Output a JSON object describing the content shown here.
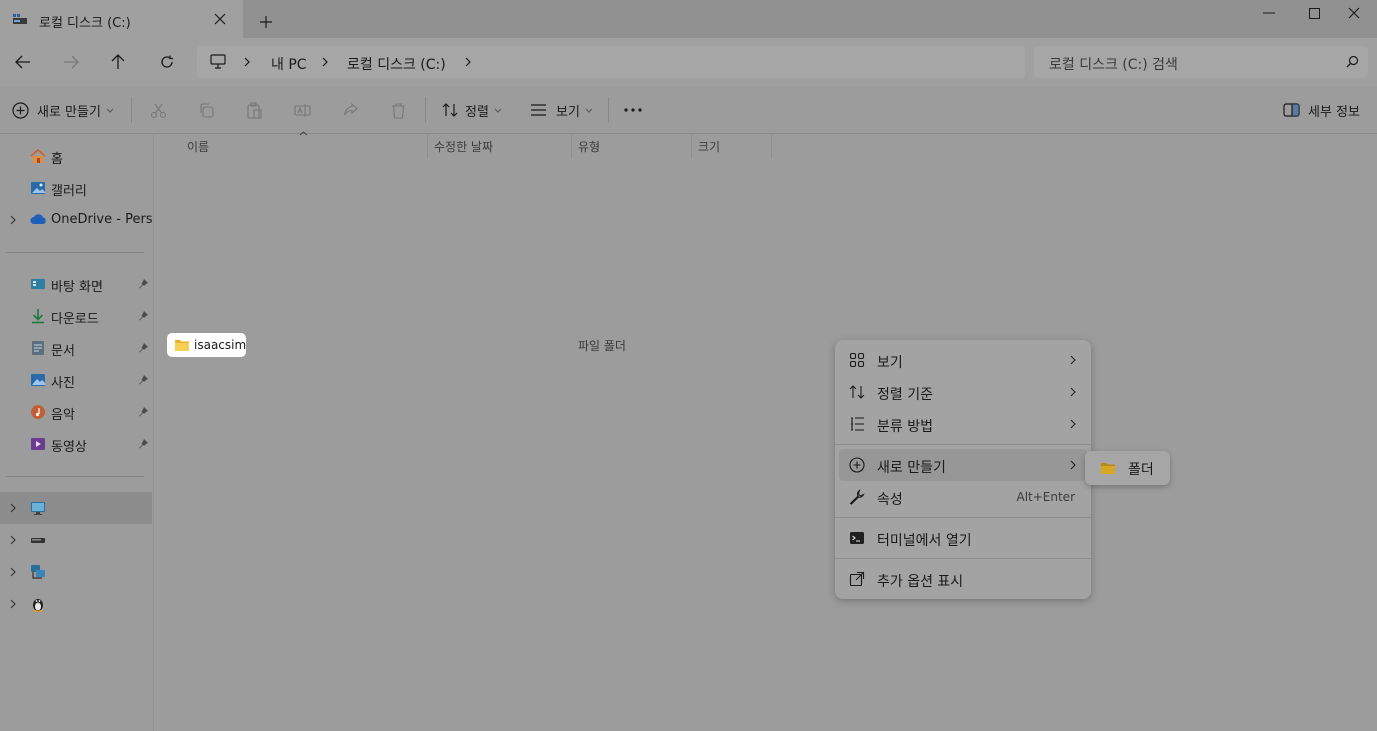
{
  "window": {
    "tab_title": "로컬 디스크 (C:)"
  },
  "address": {
    "crumbs": [
      "내 PC",
      "로컬 디스크 (C:)"
    ],
    "search_placeholder": "로컬 디스크 (C:) 검색"
  },
  "toolbar": {
    "new_label": "새로 만들기",
    "sort_label": "정렬",
    "view_label": "보기",
    "details_label": "세부 정보"
  },
  "sidebar": {
    "top_items": [
      {
        "label": "홈",
        "icon": "home-icon"
      },
      {
        "label": "갤러리",
        "icon": "gallery-icon"
      },
      {
        "label": "OneDrive - Personal",
        "icon": "onedrive-icon"
      }
    ],
    "quick_items": [
      {
        "label": "바탕 화면",
        "icon": "desktop-icon"
      },
      {
        "label": "다운로드",
        "icon": "download-icon"
      },
      {
        "label": "문서",
        "icon": "documents-icon"
      },
      {
        "label": "사진",
        "icon": "pictures-icon"
      },
      {
        "label": "음악",
        "icon": "music-icon"
      },
      {
        "label": "동영상",
        "icon": "videos-icon"
      }
    ],
    "devices": [
      {
        "icon": "this-pc-icon"
      },
      {
        "icon": "drive-icon"
      },
      {
        "icon": "network-icon"
      },
      {
        "icon": "linux-icon"
      }
    ]
  },
  "columns": {
    "name": "이름",
    "modified": "수정한 날짜",
    "type": "유형",
    "size": "크기"
  },
  "files": [
    {
      "name": "isaacsim",
      "type": "파일 폴더"
    }
  ],
  "context_menu": {
    "items": [
      {
        "label": "보기",
        "icon": "view-grid-icon"
      },
      {
        "label": "정렬 기준",
        "icon": "sort-icon"
      },
      {
        "label": "분류 방법",
        "icon": "group-by-icon"
      },
      {
        "label": "새로 만들기",
        "icon": "new-item-icon"
      },
      {
        "label": "속성",
        "icon": "properties-icon",
        "shortcut": "Alt+Enter"
      },
      {
        "label": "터미널에서 열기",
        "icon": "terminal-icon"
      },
      {
        "label": "추가 옵션 표시",
        "icon": "more-options-icon"
      }
    ],
    "submenu": {
      "label": "폴더",
      "icon": "folder-icon"
    }
  }
}
